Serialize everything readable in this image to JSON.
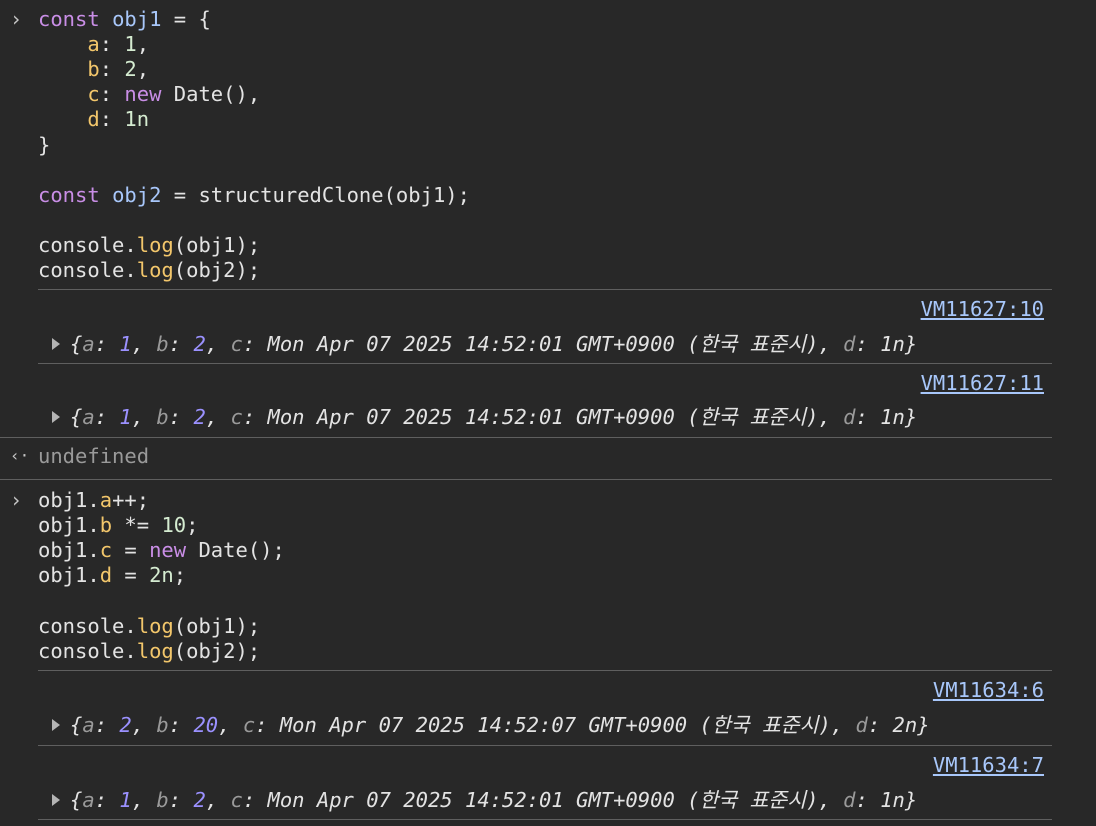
{
  "prompt_glyph": "›",
  "return_glyph": "‹·",
  "block1": {
    "lines": [
      [
        [
          "kw",
          "const"
        ],
        [
          "txt",
          " "
        ],
        [
          "var",
          "obj1"
        ],
        [
          "txt",
          " = {"
        ]
      ],
      [
        [
          "txt",
          "    "
        ],
        [
          "prop",
          "a"
        ],
        [
          "txt",
          ": "
        ],
        [
          "num",
          "1"
        ],
        [
          "txt",
          ","
        ]
      ],
      [
        [
          "txt",
          "    "
        ],
        [
          "prop",
          "b"
        ],
        [
          "txt",
          ": "
        ],
        [
          "num",
          "2"
        ],
        [
          "txt",
          ","
        ]
      ],
      [
        [
          "txt",
          "    "
        ],
        [
          "prop",
          "c"
        ],
        [
          "txt",
          ": "
        ],
        [
          "kw",
          "new"
        ],
        [
          "txt",
          " Date(),"
        ]
      ],
      [
        [
          "txt",
          "    "
        ],
        [
          "prop",
          "d"
        ],
        [
          "txt",
          ": "
        ],
        [
          "num",
          "1n"
        ]
      ],
      [
        [
          "txt",
          "}"
        ]
      ],
      [],
      [
        [
          "kw",
          "const"
        ],
        [
          "txt",
          " "
        ],
        [
          "var",
          "obj2"
        ],
        [
          "txt",
          " = structuredClone(obj1);"
        ]
      ],
      [],
      [
        [
          "txt",
          "console."
        ],
        [
          "fn",
          "log"
        ],
        [
          "txt",
          "(obj1);"
        ]
      ],
      [
        [
          "txt",
          "console."
        ],
        [
          "fn",
          "log"
        ],
        [
          "txt",
          "(obj2);"
        ]
      ]
    ]
  },
  "outputs1": [
    {
      "source": "VM11627:10",
      "a": "1",
      "b": "2",
      "c": "Mon Apr 07 2025 14:52:01 GMT+0900 (한국 표준시)",
      "d": "1n"
    },
    {
      "source": "VM11627:11",
      "a": "1",
      "b": "2",
      "c": "Mon Apr 07 2025 14:52:01 GMT+0900 (한국 표준시)",
      "d": "1n"
    }
  ],
  "return_value": "undefined",
  "block2": {
    "lines": [
      [
        [
          "txt",
          "obj1."
        ],
        [
          "prop",
          "a"
        ],
        [
          "txt",
          "++;"
        ]
      ],
      [
        [
          "txt",
          "obj1."
        ],
        [
          "prop",
          "b"
        ],
        [
          "txt",
          " *= "
        ],
        [
          "num",
          "10"
        ],
        [
          "txt",
          ";"
        ]
      ],
      [
        [
          "txt",
          "obj1."
        ],
        [
          "prop",
          "c"
        ],
        [
          "txt",
          " = "
        ],
        [
          "kw",
          "new"
        ],
        [
          "txt",
          " Date();"
        ]
      ],
      [
        [
          "txt",
          "obj1."
        ],
        [
          "prop",
          "d"
        ],
        [
          "txt",
          " = "
        ],
        [
          "num",
          "2n"
        ],
        [
          "txt",
          ";"
        ]
      ],
      [],
      [
        [
          "txt",
          "console."
        ],
        [
          "fn",
          "log"
        ],
        [
          "txt",
          "(obj1);"
        ]
      ],
      [
        [
          "txt",
          "console."
        ],
        [
          "fn",
          "log"
        ],
        [
          "txt",
          "(obj2);"
        ]
      ]
    ]
  },
  "outputs2": [
    {
      "source": "VM11634:6",
      "a": "2",
      "b": "20",
      "c": "Mon Apr 07 2025 14:52:07 GMT+0900 (한국 표준시)",
      "d": "2n"
    },
    {
      "source": "VM11634:7",
      "a": "1",
      "b": "2",
      "c": "Mon Apr 07 2025 14:52:01 GMT+0900 (한국 표준시)",
      "d": "1n"
    }
  ]
}
